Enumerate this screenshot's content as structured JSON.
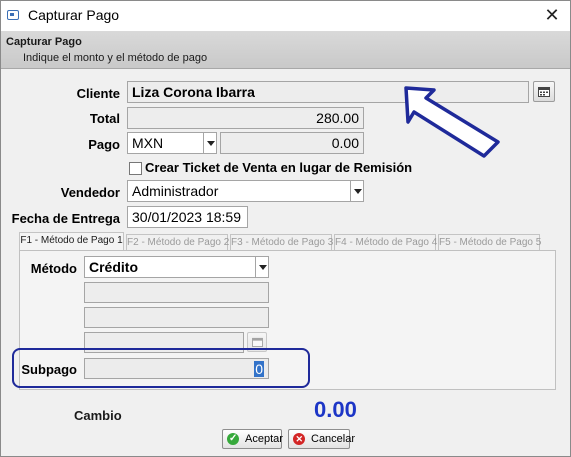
{
  "window": {
    "title": "Capturar Pago",
    "close_glyph": "✕"
  },
  "header": {
    "title": "Capturar Pago",
    "subtitle": "Indique el monto y el método de pago"
  },
  "form": {
    "cliente_label": "Cliente",
    "cliente_value": "Liza Corona Ibarra",
    "total_label": "Total",
    "total_value": "280.00",
    "pago_label": "Pago",
    "currency_value": "MXN",
    "pago_amount": "0.00",
    "ticket_checkbox_label": "Crear Ticket de Venta en lugar de Remisión",
    "vendedor_label": "Vendedor",
    "vendedor_value": "Administrador",
    "fecha_label": "Fecha de Entrega",
    "fecha_value": "30/01/2023 18:59"
  },
  "tabs": [
    {
      "label": "F1 - Método de Pago 1",
      "active": true
    },
    {
      "label": "F2 - Método de Pago 2",
      "active": false
    },
    {
      "label": "F3 - Método de Pago 3",
      "active": false
    },
    {
      "label": "F4 - Método de Pago 4",
      "active": false
    },
    {
      "label": "F5 - Método de Pago 5",
      "active": false
    }
  ],
  "payment": {
    "metodo_label": "Método",
    "metodo_value": "Crédito",
    "subpago_label": "Subpago",
    "subpago_value": "0"
  },
  "cambio": {
    "label": "Cambio",
    "value": "0.00"
  },
  "buttons": {
    "accept": "Aceptar",
    "cancel": "Cancelar"
  },
  "colors": {
    "cambio": "#1c35c6",
    "highlight_border": "#1f2a9a",
    "arrow": "#1f2a9a"
  }
}
